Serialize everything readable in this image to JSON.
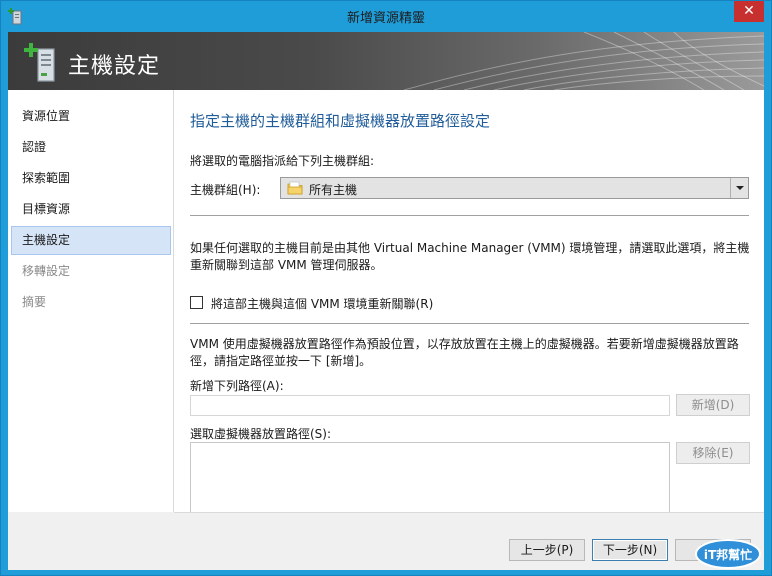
{
  "window": {
    "title": "新增資源精靈",
    "close_glyph": "✕"
  },
  "banner": {
    "title": "主機設定",
    "icon": "server-add-icon"
  },
  "nav": {
    "items": [
      {
        "label": "資源位置",
        "state": "normal"
      },
      {
        "label": "認證",
        "state": "normal"
      },
      {
        "label": "探索範圍",
        "state": "normal"
      },
      {
        "label": "目標資源",
        "state": "normal"
      },
      {
        "label": "主機設定",
        "state": "selected"
      },
      {
        "label": "移轉設定",
        "state": "disabled"
      },
      {
        "label": "摘要",
        "state": "disabled"
      }
    ]
  },
  "main": {
    "heading": "指定主機的主機群組和虛擬機器放置路徑設定",
    "assign_text": "將選取的電腦指派給下列主機群組:",
    "host_group_label": "主機群組(H):",
    "host_group_value": "所有主機",
    "reassoc_text_1": "如果任何選取的主機目前是由其他 Virtual Machine Manager (VMM) 環境管理，請選取此選項，將主機",
    "reassoc_text_2": "重新關聯到這部 VMM 管理伺服器。",
    "reassoc_checkbox_label": "將這部主機與這個 VMM 環境重新關聯(R)",
    "reassoc_checked": false,
    "placement_text_1": "VMM 使用虛擬機器放置路徑作為預設位置，以存放放置在主機上的虛擬機器。若要新增虛擬機器放置路",
    "placement_text_2": "徑，請指定路徑並按一下 [新增]。",
    "add_path_label": "新增下列路徑(A):",
    "add_path_value": "",
    "add_button": "新增(D)",
    "select_paths_label": "選取虛擬機器放置路徑(S):",
    "remove_button": "移除(E)"
  },
  "footer": {
    "prev_button": "上一步(P)",
    "next_button": "下一步(N)",
    "cancel_button": "取消"
  },
  "watermark": {
    "text": "iT邦幫忙"
  },
  "colors": {
    "titlebar": "#1F9DD9",
    "heading": "#1F5C99",
    "selected_nav": "#D5E4F6",
    "close": "#C7302F"
  }
}
